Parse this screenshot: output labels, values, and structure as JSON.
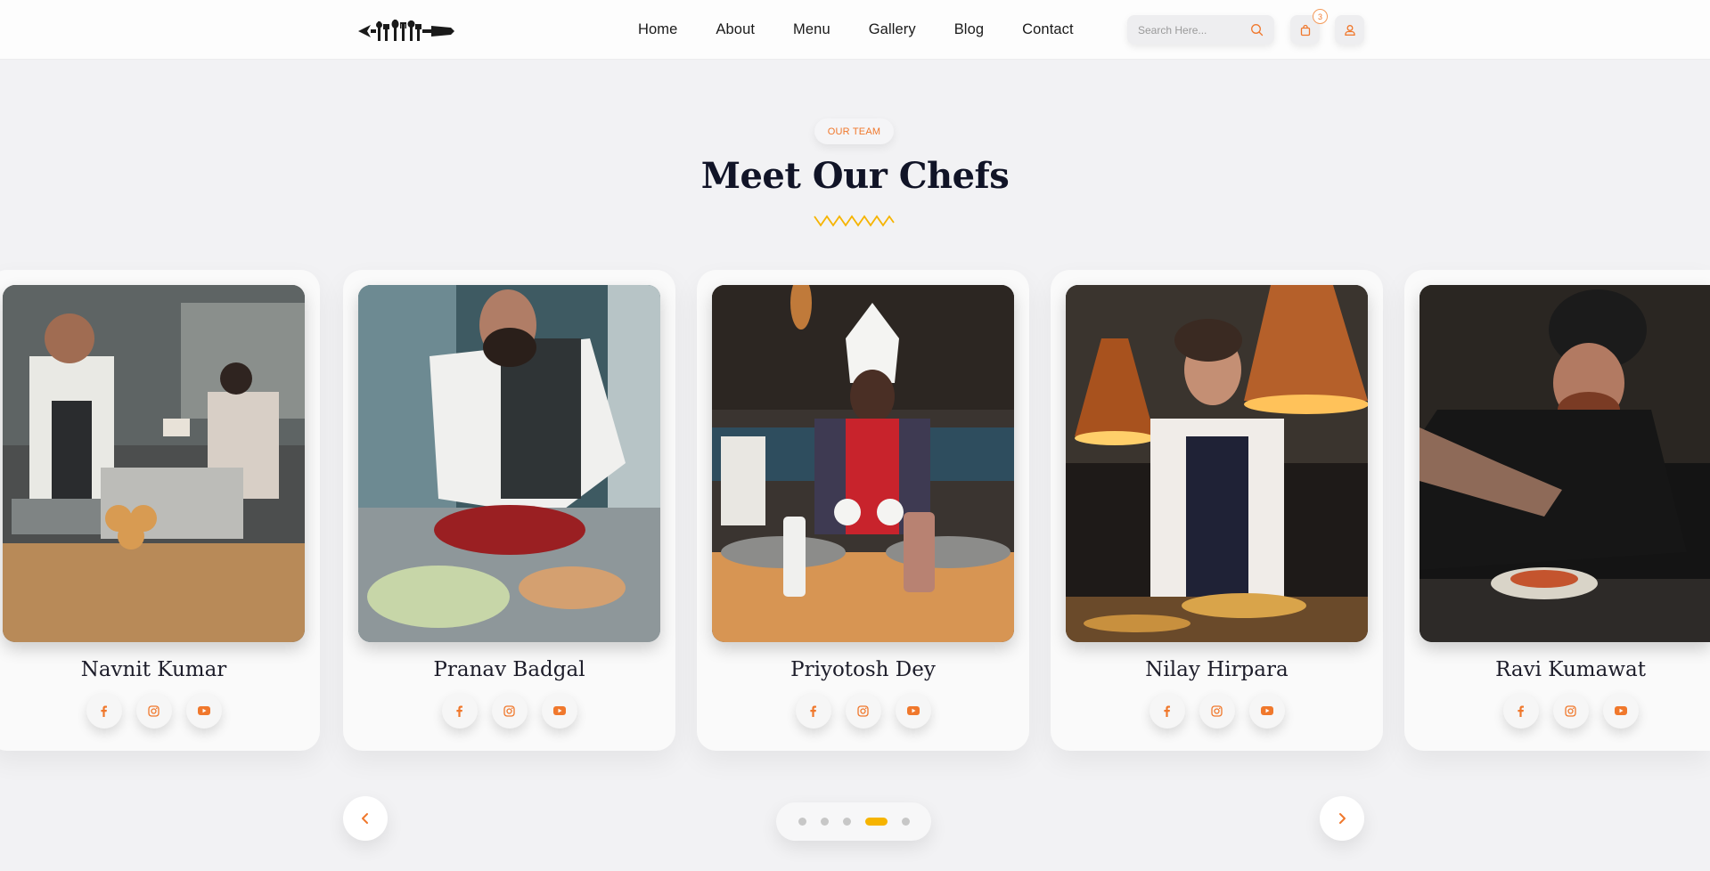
{
  "header": {
    "logo_icon": "forks-spoons-logo-icon",
    "nav": [
      "Home",
      "About",
      "Menu",
      "Gallery",
      "Blog",
      "Contact"
    ],
    "search_placeholder": "Search Here...",
    "cart_count": "3",
    "icons": {
      "search": "search-icon",
      "cart": "shopping-bag-icon",
      "user": "user-icon"
    }
  },
  "section": {
    "tag": "OUR TEAM",
    "title": "Meet Our Chefs"
  },
  "chefs": [
    {
      "name": "Navnit Kumar",
      "photo": "chef-at-kitchen-counter-photo"
    },
    {
      "name": "Pranav Badgal",
      "photo": "chef-slicing-meat-photo"
    },
    {
      "name": "Priyotosh Dey",
      "photo": "chef-in-red-apron-photo"
    },
    {
      "name": "Nilay Hirpara",
      "photo": "chef-under-copper-lamps-photo"
    },
    {
      "name": "Ravi Kumawat",
      "photo": "chef-plating-dish-photo"
    }
  ],
  "social_icons": [
    "facebook-icon",
    "instagram-icon",
    "youtube-icon"
  ],
  "slider": {
    "dot_count": 5,
    "active_dot": 4,
    "prev_icon": "chevron-left-icon",
    "next_icon": "chevron-right-icon"
  },
  "colors": {
    "accent": "#f0782c",
    "active_dot": "#f6b400",
    "zigzag": "#f6b400",
    "title": "#111427"
  }
}
